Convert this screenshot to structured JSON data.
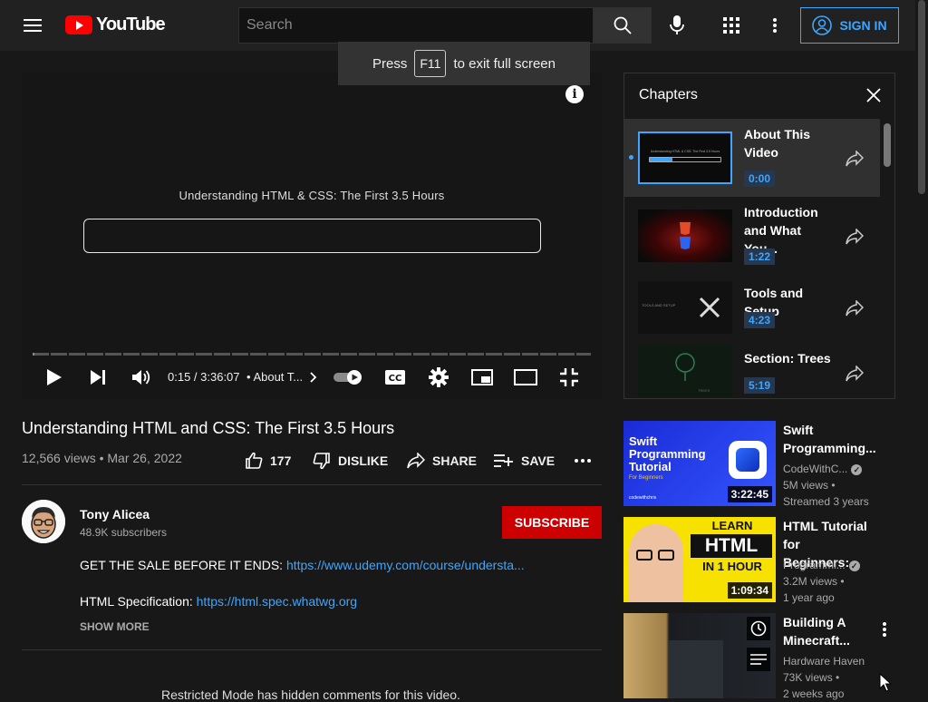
{
  "header": {
    "logo_text": "YouTube",
    "search_placeholder": "Search",
    "signin_label": "SIGN IN"
  },
  "toast": {
    "press": "Press",
    "key": "F11",
    "rest": "to exit full screen"
  },
  "player": {
    "frame_title": "Understanding HTML & CSS: The First 3.5 Hours",
    "time": "0:15 / 3:36:07",
    "chapter_label": "• About T...",
    "info_glyph": "i",
    "progress_fraction": 0.001
  },
  "video": {
    "title": "Understanding HTML and CSS: The First 3.5 Hours",
    "views_date": "12,566 views • Mar 26, 2022",
    "likes": "177",
    "dislike_label": "DISLIKE",
    "share_label": "SHARE",
    "save_label": "SAVE"
  },
  "channel": {
    "name": "Tony Alicea",
    "subscribers": "48.9K subscribers",
    "subscribe_label": "SUBSCRIBE"
  },
  "description": {
    "line1_text": "GET THE SALE BEFORE IT ENDS: ",
    "line1_link": "https://www.udemy.com/course/understa...",
    "line2_text": "HTML Specification: ",
    "line2_link": "https://html.spec.whatwg.org",
    "show_more": "SHOW MORE"
  },
  "comments_notice": "Restricted Mode has hidden comments for this video.",
  "chapters": {
    "title": "Chapters",
    "items": [
      {
        "title": "About This Video",
        "time": "0:00",
        "thumb_text": "Understanding HTML & CSS: The First 3.5 Hours"
      },
      {
        "title": "Introduction and What You...",
        "time": "1:22"
      },
      {
        "title": "Tools and Setup",
        "time": "4:23",
        "thumb_text": "TOOLS AND SETUP"
      },
      {
        "title": "Section: Trees",
        "time": "5:19",
        "thumb_text": "TREES"
      }
    ]
  },
  "recommendations": [
    {
      "title": "Swift Programming...",
      "channel": "CodeWithC...",
      "views": "5M views •",
      "age": "Streamed 3 years",
      "duration": "3:22:45",
      "thumb_lines": [
        "Swift",
        "Programming",
        "Tutorial"
      ],
      "thumb_sub": "For Beginners",
      "thumb_brand": "codewithchris"
    },
    {
      "title": "HTML Tutorial for Beginners:...",
      "channel": "Programmi...",
      "views": "3.2M views •",
      "age": "1 year ago",
      "duration": "1:09:34",
      "thumb_lines": [
        "LEARN",
        "HTML",
        "IN 1 HOUR"
      ]
    },
    {
      "title": "Building A Minecraft...",
      "channel": "Hardware Haven",
      "views": "73K views •",
      "age": "2 weeks ago"
    }
  ],
  "colors": {
    "accent_blue": "#3ea6ff",
    "subscribe_red": "#cc0000",
    "background": "#181818"
  }
}
